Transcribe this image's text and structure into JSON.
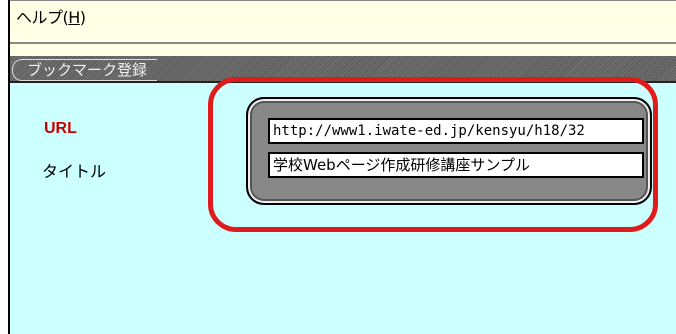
{
  "menu": {
    "help_label": "ヘルプ(",
    "help_accel": "H",
    "help_close": ")"
  },
  "window": {
    "title": "ブックマーク登録"
  },
  "form": {
    "url_label": "URL",
    "title_label": "タイトル",
    "url_value": "http://www1.iwate-ed.jp/kensyu/h18/32",
    "title_value": "学校Webページ作成研修講座サンプル"
  },
  "colors": {
    "background": "#ccffff",
    "url_label": "#cc0000",
    "highlight": "#e01b1b"
  }
}
